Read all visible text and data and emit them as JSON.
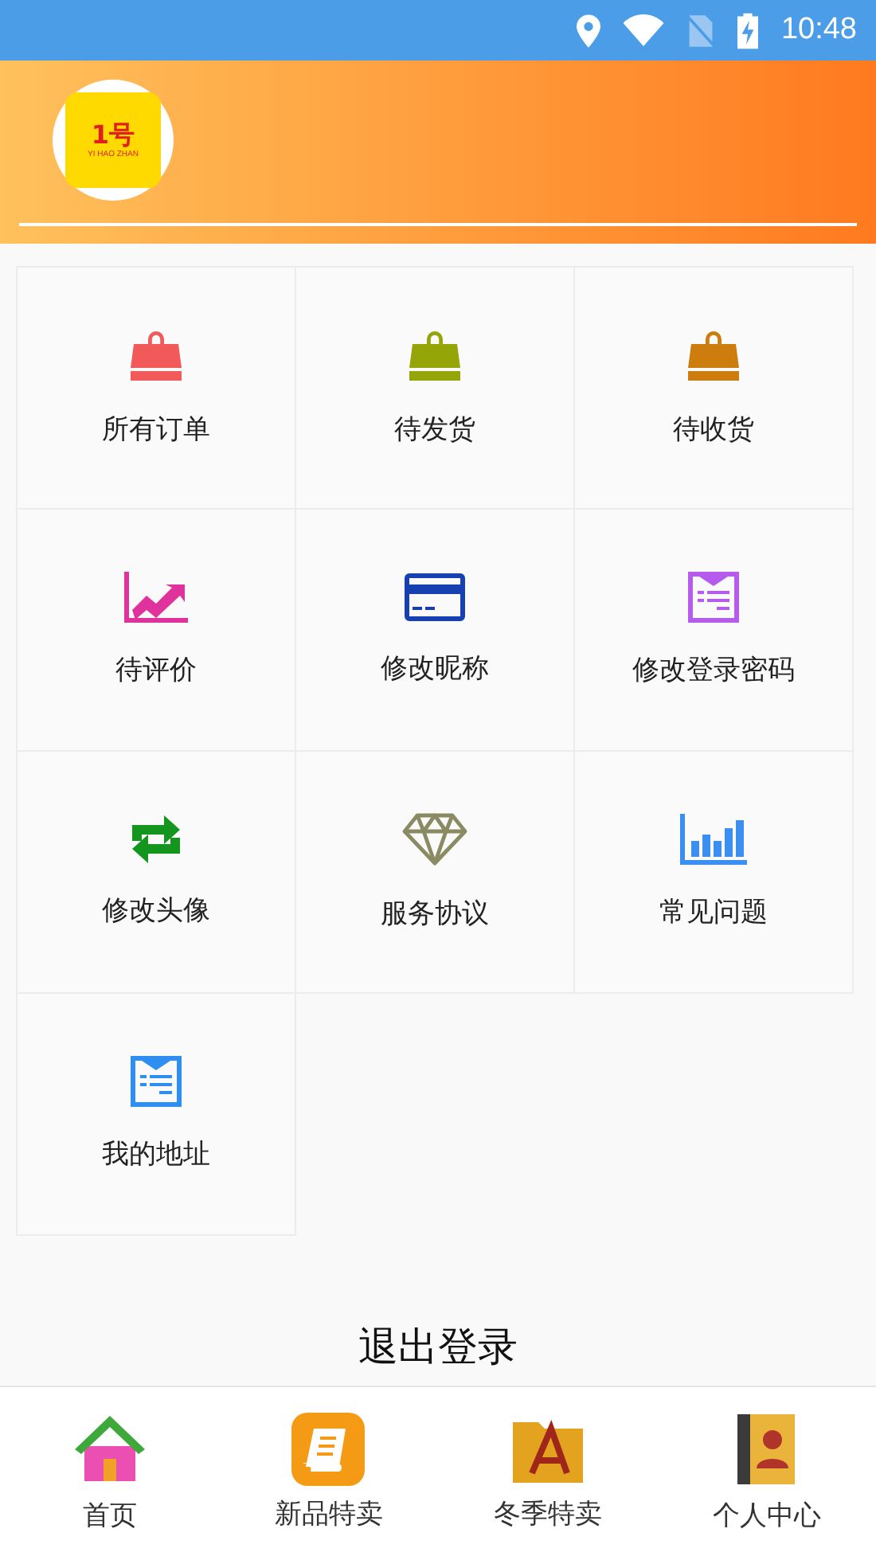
{
  "status_bar": {
    "time": "10:48"
  },
  "header": {
    "logo": {
      "mark": "1号",
      "caption": "YI HAO ZHAN"
    }
  },
  "menu": [
    {
      "label": "所有订单",
      "kind": "bag",
      "color": "#f25a5a"
    },
    {
      "label": "待发货",
      "kind": "bag",
      "color": "#95a406"
    },
    {
      "label": "待收货",
      "kind": "bag",
      "color": "#cc7d0e"
    },
    {
      "label": "待评价",
      "kind": "chart",
      "color": "#e0329c"
    },
    {
      "label": "修改昵称",
      "kind": "card",
      "color": "#1740b0"
    },
    {
      "label": "修改登录密码",
      "kind": "form",
      "color": "#b55ced"
    },
    {
      "label": "修改头像",
      "kind": "swap",
      "color": "#14961e"
    },
    {
      "label": "服务协议",
      "kind": "diamond",
      "color": "#8a8a63"
    },
    {
      "label": "常见问题",
      "kind": "bars",
      "color": "#3a8ff0"
    },
    {
      "label": "我的地址",
      "kind": "form",
      "color": "#2f8ff0"
    }
  ],
  "logout": "退出登录",
  "bottom_nav": [
    {
      "label": "首页",
      "kind": "home"
    },
    {
      "label": "新品特卖",
      "kind": "note"
    },
    {
      "label": "冬季特卖",
      "kind": "folder"
    },
    {
      "label": "个人中心",
      "kind": "contacts"
    }
  ]
}
